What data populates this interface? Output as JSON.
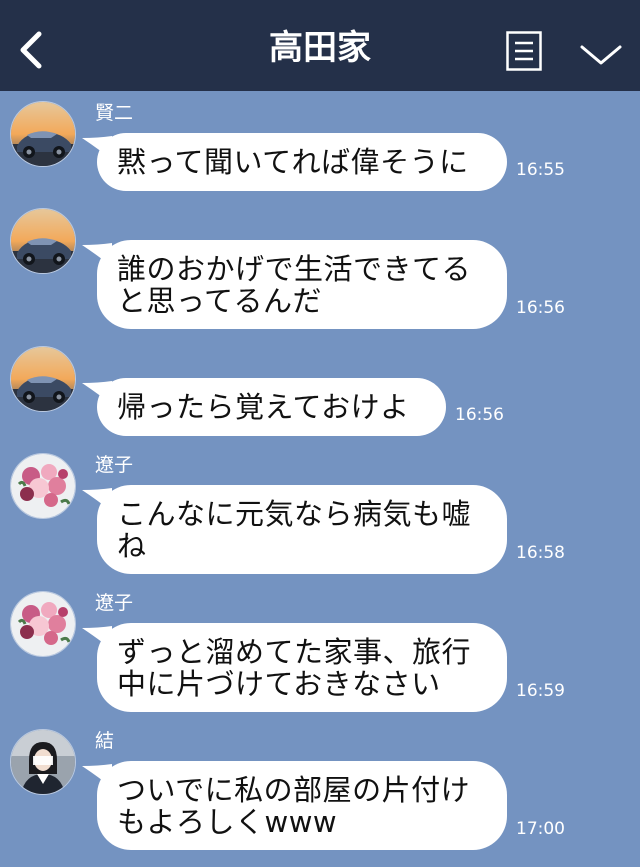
{
  "header": {
    "title": "高田家"
  },
  "messages": [
    {
      "sender": "賢二",
      "avatar": "car-avatar",
      "text": "黙って聞いてれば偉そうに",
      "time": "16:55"
    },
    {
      "sender": "",
      "avatar": "car-avatar",
      "text": "誰のおかげで生活できてる\nと思ってるんだ",
      "time": "16:56"
    },
    {
      "sender": "",
      "avatar": "car-avatar",
      "text": "帰ったら覚えておけよ",
      "time": "16:56"
    },
    {
      "sender": "遼子",
      "avatar": "flowers-avatar",
      "text": "こんなに元気なら病気も嘘\nね",
      "time": "16:58"
    },
    {
      "sender": "遼子",
      "avatar": "flowers-avatar",
      "text": "ずっと溜めてた家事、旅行\n中に片づけておきなさい",
      "time": "16:59"
    },
    {
      "sender": "結",
      "avatar": "girl-avatar",
      "text": "ついでに私の部屋の片付け\nもよろしくwww",
      "time": "17:00"
    }
  ],
  "colors": {
    "background": "#7493c1",
    "header": "#243049",
    "bubble": "#ffffff"
  }
}
